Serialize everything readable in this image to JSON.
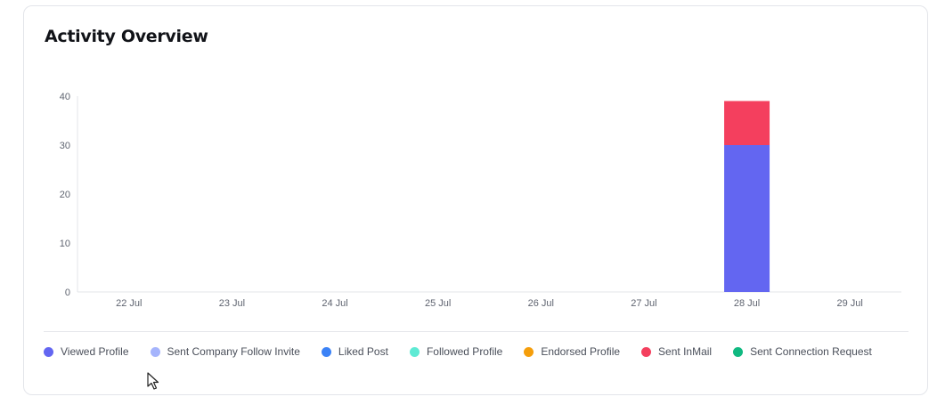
{
  "card": {
    "title": "Activity Overview"
  },
  "chart_data": {
    "type": "bar",
    "stacked": true,
    "title": "Activity Overview",
    "xlabel": "",
    "ylabel": "",
    "categories": [
      "22 Jul",
      "23 Jul",
      "24 Jul",
      "25 Jul",
      "26 Jul",
      "27 Jul",
      "28 Jul",
      "29 Jul"
    ],
    "ylim": [
      0,
      40
    ],
    "yticks": [
      "0",
      "10",
      "20",
      "30",
      "40"
    ],
    "grid": false,
    "legend_position": "bottom",
    "series": [
      {
        "name": "Viewed Profile",
        "color": "#6366f1",
        "values": [
          0,
          0,
          0,
          0,
          0,
          0,
          30,
          0
        ]
      },
      {
        "name": "Sent Company Follow Invite",
        "color": "#a5b4fc",
        "values": [
          0,
          0,
          0,
          0,
          0,
          0,
          0,
          0
        ]
      },
      {
        "name": "Liked Post",
        "color": "#3b82f6",
        "values": [
          0,
          0,
          0,
          0,
          0,
          0,
          0,
          0
        ]
      },
      {
        "name": "Followed Profile",
        "color": "#5eead4",
        "values": [
          0,
          0,
          0,
          0,
          0,
          0,
          0,
          0
        ]
      },
      {
        "name": "Endorsed Profile",
        "color": "#f59e0b",
        "values": [
          0,
          0,
          0,
          0,
          0,
          0,
          0,
          0
        ]
      },
      {
        "name": "Sent InMail",
        "color": "#f43f5e",
        "values": [
          0,
          0,
          0,
          0,
          0,
          0,
          9,
          0
        ]
      },
      {
        "name": "Sent Connection Request",
        "color": "#10b981",
        "values": [
          0,
          0,
          0,
          0,
          0,
          0,
          0,
          0
        ]
      }
    ]
  },
  "legend": {
    "items": [
      {
        "label": "Viewed Profile",
        "color": "#6366f1"
      },
      {
        "label": "Sent Company Follow Invite",
        "color": "#a5b4fc"
      },
      {
        "label": "Liked Post",
        "color": "#3b82f6"
      },
      {
        "label": "Followed Profile",
        "color": "#5eead4"
      },
      {
        "label": "Endorsed Profile",
        "color": "#f59e0b"
      },
      {
        "label": "Sent InMail",
        "color": "#f43f5e"
      },
      {
        "label": "Sent Connection Request",
        "color": "#10b981"
      }
    ]
  }
}
